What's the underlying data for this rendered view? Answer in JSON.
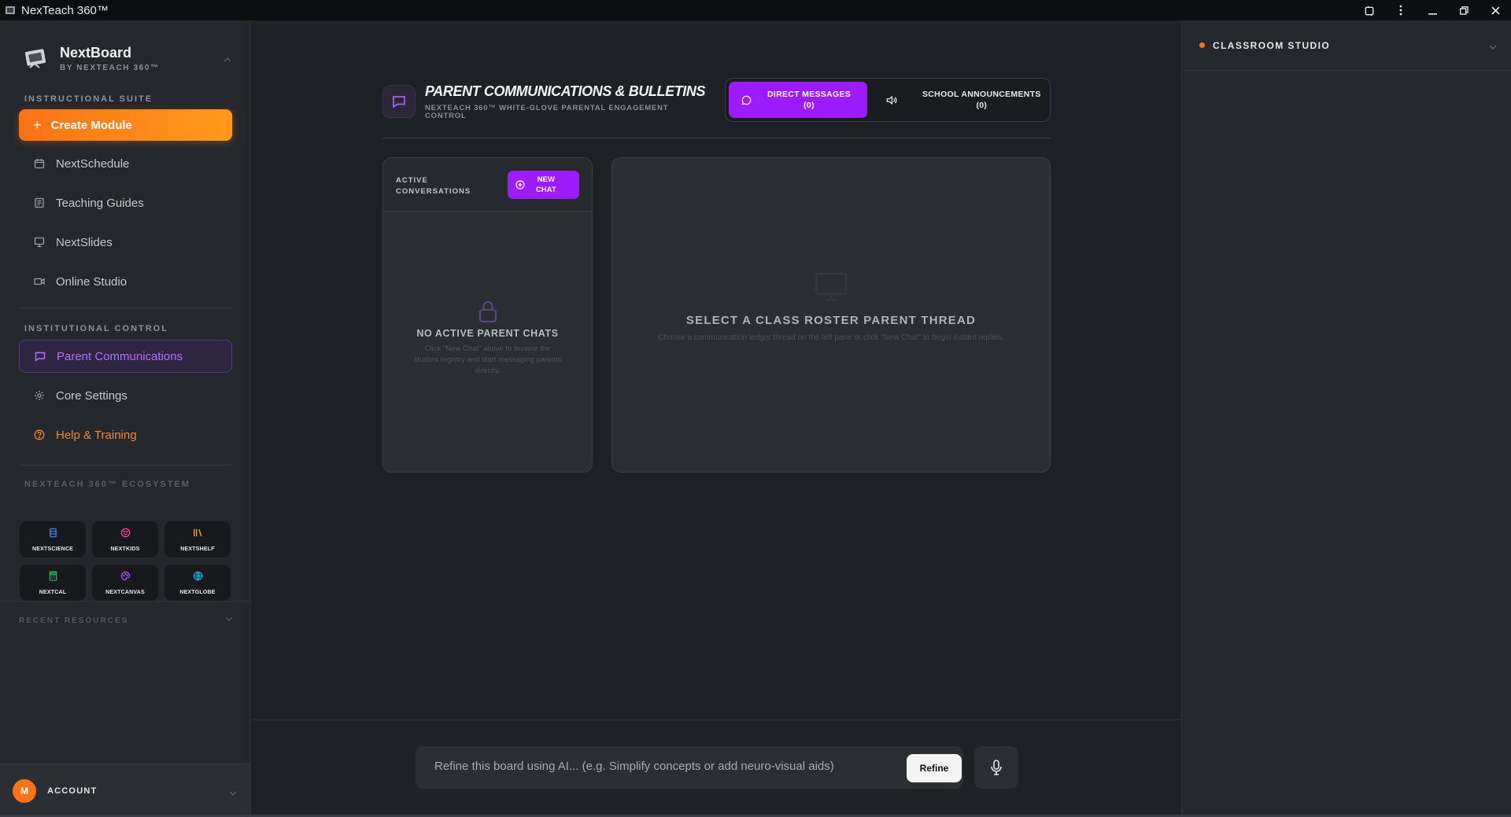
{
  "window": {
    "title": "NexTeach 360™"
  },
  "brand": {
    "name": "NextBoard",
    "subtitle": "BY NEXTEACH 360™"
  },
  "sidebar": {
    "sections": {
      "instructional": "INSTRUCTIONAL SUITE",
      "institutional": "INSTITUTIONAL CONTROL",
      "ecosystem": "NEXTEACH 360™ ECOSYSTEM",
      "recent": "RECENT RESOURCES"
    },
    "create_label": "Create Module",
    "items": [
      {
        "label": "NextSchedule",
        "icon": "calendar-icon"
      },
      {
        "label": "Teaching Guides",
        "icon": "book-icon"
      },
      {
        "label": "NextSlides",
        "icon": "presentation-icon"
      },
      {
        "label": "Online Studio",
        "icon": "video-icon"
      }
    ],
    "control_items": [
      {
        "label": "Parent Communications",
        "icon": "message-icon",
        "active": true
      },
      {
        "label": "Core Settings",
        "icon": "gear-icon"
      },
      {
        "label": "Help & Training",
        "icon": "help-icon"
      }
    ],
    "ecosystem": [
      {
        "label": "NEXTSCIENCE",
        "icon": "flask-icon",
        "color": "#3b82f6"
      },
      {
        "label": "NEXTKIDS",
        "icon": "smile-icon",
        "color": "#ec4899"
      },
      {
        "label": "NEXTSHELF",
        "icon": "library-icon",
        "color": "#f59e0b"
      },
      {
        "label": "NEXTCAL",
        "icon": "calculator-icon",
        "color": "#22c55e"
      },
      {
        "label": "NEXTCANVAS",
        "icon": "palette-icon",
        "color": "#a855f7"
      },
      {
        "label": "NEXTGLOBE",
        "icon": "globe-icon",
        "color": "#06b6d4"
      }
    ],
    "account": {
      "initial": "M",
      "label": "ACCOUNT"
    }
  },
  "main": {
    "title": "PARENT COMMUNICATIONS & BULLETINS",
    "subtitle": "NEXTEACH 360™ WHITE-GLOVE PARENTAL ENGAGEMENT CONTROL",
    "tabs": [
      {
        "label_line1": "DIRECT MESSAGES",
        "label_line2": "(0)",
        "active": true
      },
      {
        "label_line1": "SCHOOL ANNOUNCEMENTS",
        "label_line2": "(0)",
        "active": false
      }
    ],
    "conversations": {
      "header_line1": "ACTIVE",
      "header_line2": "CONVERSATIONS",
      "new_chat_line1": "NEW",
      "new_chat_line2": "CHAT",
      "empty_title": "NO ACTIVE PARENT CHATS",
      "empty_desc": "Click \"New Chat\" above to browse the student registry and start messaging parents directly."
    },
    "thread": {
      "title": "SELECT A CLASS ROSTER PARENT THREAD",
      "desc": "Choose a communication ledger thread on the left pane or click \"New Chat\" to begin instant replies."
    },
    "refine": {
      "placeholder": "Refine this board using AI... (e.g. Simplify concepts or add neuro-visual aids)",
      "button": "Refine"
    }
  },
  "right_panel": {
    "title": "CLASSROOM STUDIO"
  },
  "colors": {
    "accent_orange": "#f97316",
    "accent_purple": "#9c1cff",
    "background": "#1e2126"
  }
}
